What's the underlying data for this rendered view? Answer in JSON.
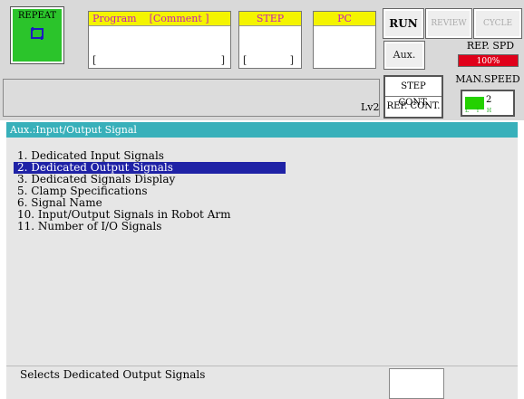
{
  "header": {
    "repeat_label": "REPEAT",
    "program_label": "Program",
    "comment_label": "[Comment ]",
    "program_open_bracket": "[",
    "program_close_bracket": "]",
    "step_label": "STEP",
    "step_open_bracket": "[",
    "step_close_bracket": "]",
    "pc_label": "PC",
    "run_label": "RUN",
    "review_label": "REVIEW",
    "cycle_label": "CYCLE",
    "aux_label": "Aux.",
    "rep_spd_label": "REP. SPD",
    "rep_spd_value": "100%",
    "level": "Lv2",
    "step_cont_label": "STEP CONT.",
    "rep_cont_label": "REP. CONT.",
    "man_speed_label": "MAN.SPEED",
    "man_speed_value": "2",
    "man_speed_level": 0.4
  },
  "title": "Aux.:Input/Output Signal",
  "menu": {
    "items": [
      "1. Dedicated Input Signals",
      "2. Dedicated Output Signals",
      "3. Dedicated Signals Display",
      "5. Clamp Specifications",
      "6. Signal Name",
      "10. Input/Output Signals in Robot Arm",
      "11. Number of I/O Signals"
    ],
    "selected_index": 1
  },
  "status": "Selects Dedicated Output Signals",
  "colors": {
    "repeat_bg": "#2bc42b",
    "title_bg": "#38b0ba",
    "selected_bg": "#1f22a6",
    "rep_spd_bg": "#e0001a",
    "box_head_bg": "#f4f400"
  }
}
